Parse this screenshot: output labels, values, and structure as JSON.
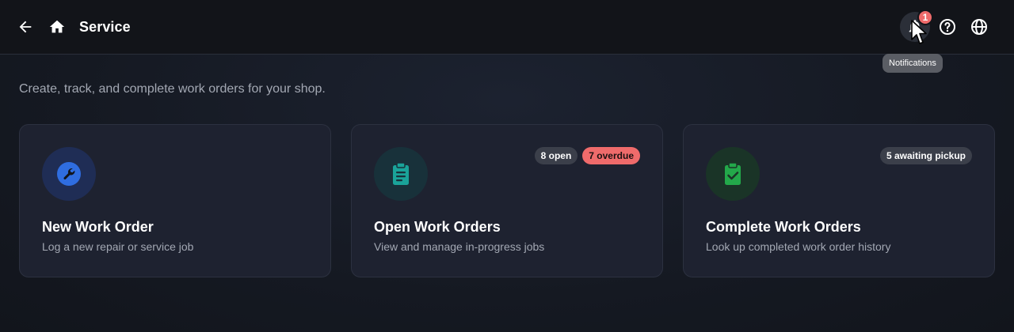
{
  "header": {
    "title": "Service",
    "notifications_count": "1",
    "tooltip": "Notifications",
    "icons": [
      "arrow-left-icon",
      "home-icon",
      "bell-icon",
      "help-circle-icon",
      "globe-icon"
    ]
  },
  "main": {
    "subtitle": "Create, track, and complete work orders for your shop."
  },
  "cards": [
    {
      "title": "New Work Order",
      "description": "Log a new repair or service job",
      "icon": "wrench-icon",
      "icon_color": "#2f6de0",
      "icon_bg": "#1f2d55",
      "badges": []
    },
    {
      "title": "Open Work Orders",
      "description": "View and manage in-progress jobs",
      "icon": "clipboard-list-icon",
      "icon_color": "#1aa399",
      "icon_bg": "#18313a",
      "badges": [
        {
          "label": "8 open",
          "style": "gray"
        },
        {
          "label": "7 overdue",
          "style": "red"
        }
      ]
    },
    {
      "title": "Complete Work Orders",
      "description": "Look up completed work order history",
      "icon": "clipboard-check-icon",
      "icon_color": "#23a84a",
      "icon_bg": "#1a3427",
      "badges": [
        {
          "label": "5 awaiting pickup",
          "style": "gray"
        }
      ]
    }
  ],
  "colors": {
    "topbar_bg": "#121419",
    "card_bg": "#1e2230",
    "badge_red": "#ef6b6b",
    "muted_text": "#a3a8b3"
  }
}
